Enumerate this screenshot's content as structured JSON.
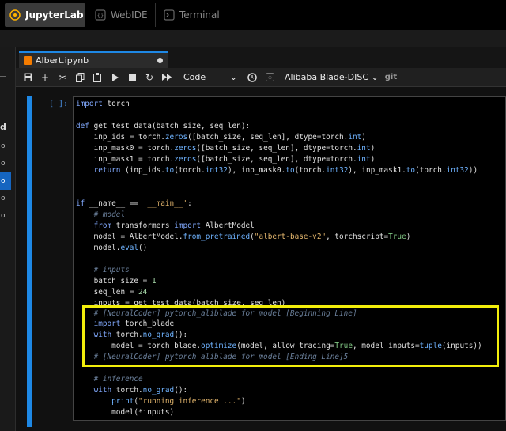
{
  "top_tabs": [
    "JupyterLab",
    "WebIDE",
    "Terminal"
  ],
  "sidebar": {
    "heading": "d",
    "items": [
      "o",
      "o",
      "o",
      "o",
      "o"
    ],
    "selected_index": 2
  },
  "notebook": {
    "tab_title": "Albert.ipynb",
    "cell_type": "Code",
    "kernel": "Alibaba Blade-DISC",
    "git_label": "git",
    "prompt": "[ ]:"
  },
  "code_lines": [
    "import torch",
    "",
    "def get_test_data(batch_size, seq_len):",
    "    inp_ids = torch.zeros([batch_size, seq_len], dtype=torch.int)",
    "    inp_mask0 = torch.zeros([batch_size, seq_len], dtype=torch.int)",
    "    inp_mask1 = torch.zeros([batch_size, seq_len], dtype=torch.int)",
    "    return (inp_ids.to(torch.int32), inp_mask0.to(torch.int32), inp_mask1.to(torch.int32))",
    "",
    "",
    "if __name__ == '__main__':",
    "    # model",
    "    from transformers import AlbertModel",
    "    model = AlbertModel.from_pretrained(\"albert-base-v2\", torchscript=True)",
    "    model.eval()",
    "",
    "    # inputs",
    "    batch_size = 1",
    "    seq_len = 24",
    "    inputs = get_test_data(batch_size, seq_len)",
    "    # [NeuralCoder] pytorch_aliblade for model [Beginning Line]",
    "    import torch_blade",
    "    with torch.no_grad():",
    "        model = torch_blade.optimize(model, allow_tracing=True, model_inputs=tuple(inputs))",
    "    # [NeuralCoder] pytorch_aliblade for model [Ending Line]5",
    "",
    "    # inference",
    "    with torch.no_grad():",
    "        print(\"running inference ...\")",
    "        model(*inputs)"
  ],
  "colors": {
    "accent": "#1e88e5",
    "highlight": "#f2ee0b",
    "keyword": "#82aaff",
    "string": "#e6b86e",
    "comment": "#6a7f9a"
  }
}
